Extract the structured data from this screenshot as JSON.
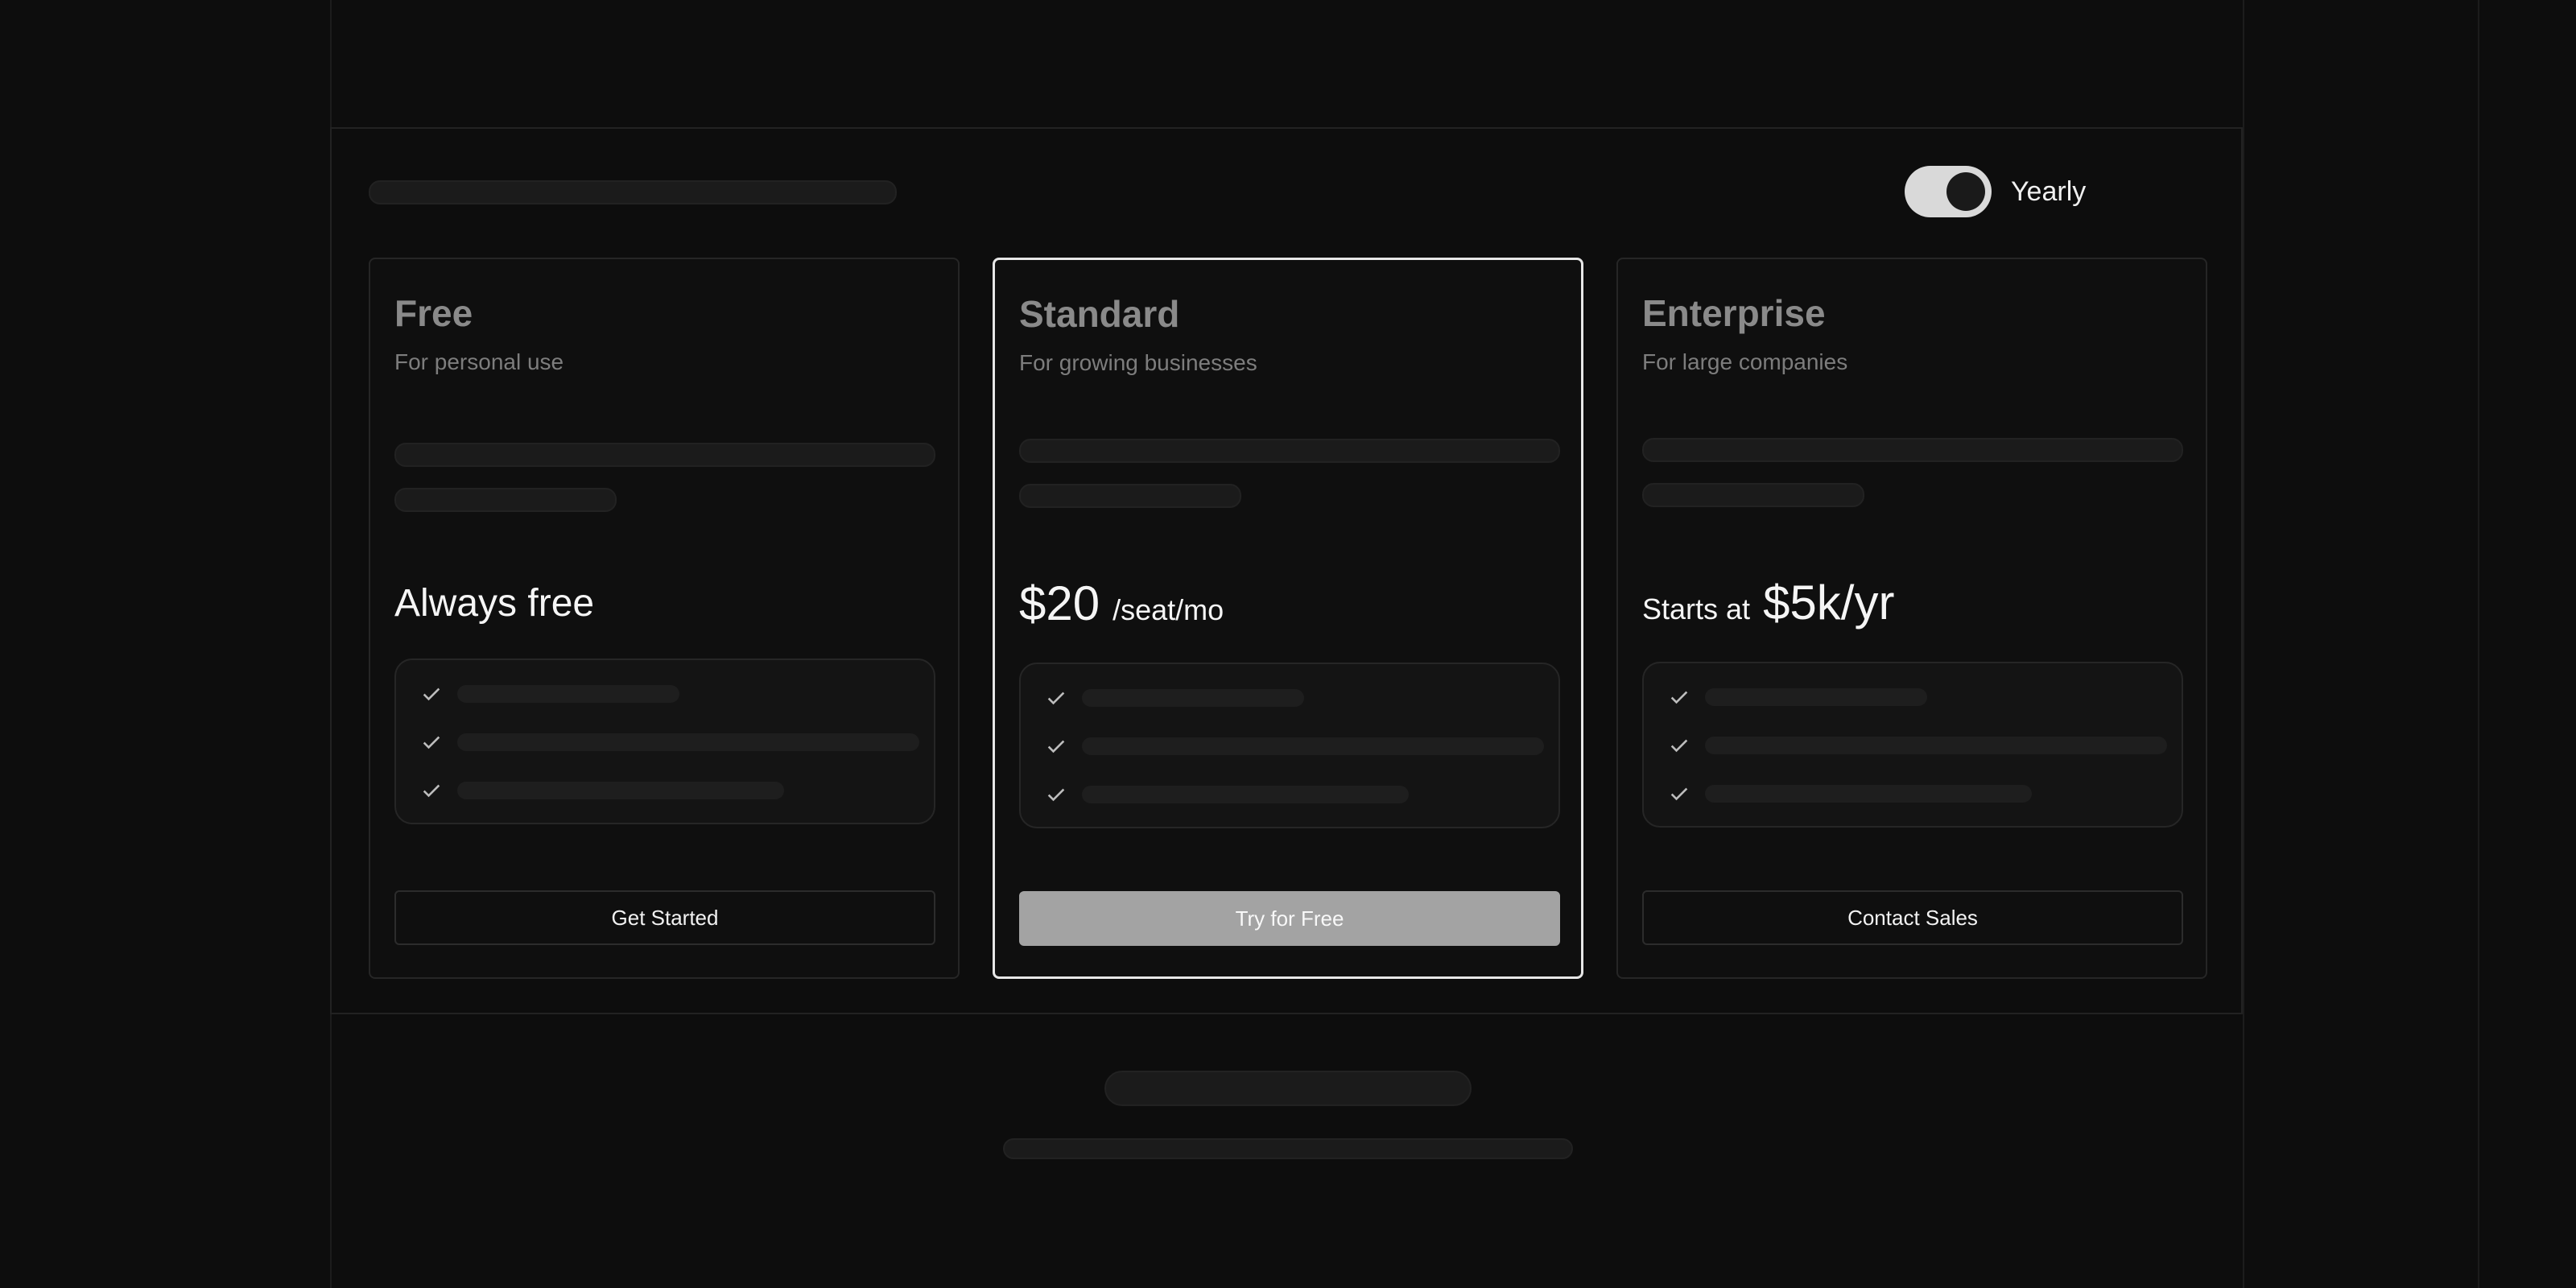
{
  "billing_toggle": {
    "label": "Yearly",
    "state": "on"
  },
  "plans": [
    {
      "name": "Free",
      "tagline": "For personal use",
      "price_text": "Always free",
      "button_label": "Get Started",
      "featured": false
    },
    {
      "name": "Standard",
      "tagline": "For growing businesses",
      "price_amount": "$20",
      "price_suffix": "/seat/mo",
      "button_label": "Try for Free",
      "featured": true
    },
    {
      "name": "Enterprise",
      "tagline": "For large companies",
      "price_prefix": "Starts at",
      "price_amount": "$5k/yr",
      "button_label": "Contact Sales",
      "featured": false
    }
  ],
  "icons": {
    "feature_check": "check-icon"
  },
  "colors": {
    "background": "#0d0d0d",
    "featured_border": "#e6e6e6",
    "primary_button": "#a3a3a3"
  }
}
